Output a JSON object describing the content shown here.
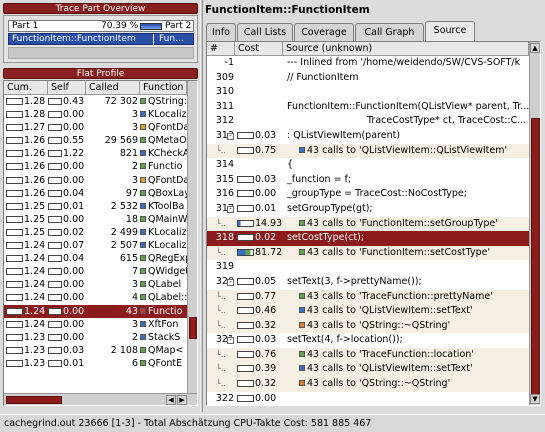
{
  "overview": {
    "dock_title": "Trace Part Overview",
    "part1": "Part 1",
    "percent": "70.39 %",
    "part2": "Part 2",
    "func1": "FunctionItem::FunctionItem",
    "func2": "Fun..."
  },
  "flat": {
    "dock_title": "Flat Profile",
    "headers": [
      "Cum.",
      "Self",
      "Called",
      "Function"
    ],
    "rows": [
      {
        "cum": "1.28",
        "self": "0.43",
        "called": "72 302",
        "color": "#5fa64f",
        "func": "QString::"
      },
      {
        "cum": "1.28",
        "self": "0.00",
        "called": "3",
        "color": "#3a6fc8",
        "func": "KLocalize"
      },
      {
        "cum": "1.27",
        "self": "0.00",
        "called": "3",
        "color": "#e0a030",
        "func": "QFontDa"
      },
      {
        "cum": "1.26",
        "self": "0.55",
        "called": "29 569",
        "color": "#5fa64f",
        "func": "QMetaO"
      },
      {
        "cum": "1.26",
        "self": "1.22",
        "called": "821",
        "color": "#3a6fc8",
        "func": "KCheckA"
      },
      {
        "cum": "1.26",
        "self": "0.00",
        "called": "2",
        "color": "#5fa64f",
        "func": "Functio"
      },
      {
        "cum": "1.26",
        "self": "0.00",
        "called": "3",
        "color": "#e0a030",
        "func": "QFontDa"
      },
      {
        "cum": "1.26",
        "self": "0.04",
        "called": "97",
        "color": "#5fa64f",
        "func": "QBoxLay"
      },
      {
        "cum": "1.25",
        "self": "0.01",
        "called": "2 532",
        "color": "#3a6fc8",
        "func": "KToolBa"
      },
      {
        "cum": "1.25",
        "self": "0.00",
        "called": "18",
        "color": "#5fa64f",
        "func": "QMainW"
      },
      {
        "cum": "1.25",
        "self": "0.02",
        "called": "2 499",
        "color": "#3a6fc8",
        "func": "KLocalize"
      },
      {
        "cum": "1.24",
        "self": "0.07",
        "called": "2 507",
        "color": "#3a6fc8",
        "func": "KLocalize"
      },
      {
        "cum": "1.24",
        "self": "0.04",
        "called": "615",
        "color": "#5fa64f",
        "func": "QRegExp"
      },
      {
        "cum": "1.24",
        "self": "0.00",
        "called": "7",
        "color": "#5fa64f",
        "func": "QWidget"
      },
      {
        "cum": "1.24",
        "self": "0.00",
        "called": "3",
        "color": "#5fa64f",
        "func": "QLabel"
      },
      {
        "cum": "1.24",
        "self": "0.00",
        "called": "4",
        "color": "#5fa64f",
        "func": "QLabel::"
      },
      {
        "cum": "1.24",
        "self": "0.00",
        "called": "43",
        "color": "#c33",
        "func": "Functio",
        "selected": true
      },
      {
        "cum": "1.24",
        "self": "0.00",
        "called": "3",
        "color": "#3a6fc8",
        "func": "XftFon"
      },
      {
        "cum": "1.23",
        "self": "0.00",
        "called": "2",
        "color": "#3a6fc8",
        "func": "StackS"
      },
      {
        "cum": "1.23",
        "self": "0.03",
        "called": "2 108",
        "color": "#5fa64f",
        "func": "QMap<"
      },
      {
        "cum": "1.23",
        "self": "0.01",
        "called": "6",
        "color": "#5fa64f",
        "func": "QFontE"
      }
    ]
  },
  "main": {
    "title": "FunctionItem::FunctionItem",
    "tabs": [
      "Info",
      "Call Lists",
      "Coverage",
      "Call Graph",
      "Source"
    ],
    "active_tab": "Source",
    "src_headers": [
      "#",
      "Cost",
      "Source (unknown)"
    ],
    "src_rows": [
      {
        "num": "-1",
        "cost": "",
        "hasbar": false,
        "text": "--- Inlined from '/home/weidendo/SW/CVS-SOFT/k"
      },
      {
        "num": "309",
        "cost": "",
        "hasbar": false,
        "text": "// FunctionItem"
      },
      {
        "num": "310",
        "cost": "",
        "hasbar": false,
        "text": ""
      },
      {
        "num": "311",
        "cost": "",
        "hasbar": false,
        "text": "FunctionItem::FunctionItem(QListView* parent, Tr..."
      },
      {
        "num": "312",
        "cost": "",
        "hasbar": false,
        "text": "TraceCostType* ct, TraceCost::C...",
        "indent": true
      },
      {
        "num": "313",
        "cost": "0.03",
        "hasbar": true,
        "text": ": QListViewItem(parent)",
        "tree": "expand"
      },
      {
        "num": "",
        "cost": "0.75",
        "hasbar": true,
        "sq": "#3a6fc8",
        "text": "43 calls to 'QListViewItem::QListViewItem'",
        "call": true,
        "tint": true
      },
      {
        "num": "314",
        "cost": "",
        "hasbar": false,
        "text": "{"
      },
      {
        "num": "315",
        "cost": "0.03",
        "hasbar": true,
        "text": "_function = f;"
      },
      {
        "num": "316",
        "cost": "0.00",
        "hasbar": true,
        "text": "_groupType = TraceCost::NoCostType;"
      },
      {
        "num": "317",
        "cost": "0.01",
        "hasbar": true,
        "text": "setGroupType(gt);",
        "tree": "expand"
      },
      {
        "num": "",
        "cost": "14.93",
        "hasbar": true,
        "fill": "#3a6fc8",
        "sq": "#5fa64f",
        "text": "43 calls to 'FunctionItem::setGroupType'",
        "call": true,
        "tint": true
      },
      {
        "num": "318",
        "cost": "0.02",
        "hasbar": true,
        "text": "setCostType(ct);",
        "selected": true
      },
      {
        "num": "",
        "cost": "81.72",
        "hasbar": true,
        "fill": "#3a6fc8",
        "fill2": "#5fa64f",
        "sq": "#5fa64f",
        "text": "43 calls to 'FunctionItem::setCostType'",
        "call": true,
        "tint": true
      },
      {
        "num": "319",
        "cost": "",
        "hasbar": false,
        "text": ""
      },
      {
        "num": "320",
        "cost": "0.05",
        "hasbar": true,
        "text": "setText(3, f->prettyName());",
        "tree": "expand"
      },
      {
        "num": "",
        "cost": "0.77",
        "hasbar": true,
        "sq": "#5fa64f",
        "text": "43 calls to 'TraceFunction::prettyName'",
        "call": true,
        "tint": true
      },
      {
        "num": "",
        "cost": "0.46",
        "hasbar": true,
        "sq": "#3a6fc8",
        "text": "43 calls to 'QListViewItem::setText'",
        "call": true,
        "tint": true
      },
      {
        "num": "",
        "cost": "0.32",
        "hasbar": true,
        "sq": "#e07a30",
        "text": "43 calls to 'QString::~QString'",
        "call": true,
        "tint": true
      },
      {
        "num": "321",
        "cost": "0.03",
        "hasbar": true,
        "text": "setText(4, f->location());",
        "tree": "expand"
      },
      {
        "num": "",
        "cost": "0.76",
        "hasbar": true,
        "sq": "#5fa64f",
        "text": "43 calls to 'TraceFunction::location'",
        "call": true,
        "tint": true
      },
      {
        "num": "",
        "cost": "0.39",
        "hasbar": true,
        "sq": "#3a6fc8",
        "text": "43 calls to 'QListViewItem::setText'",
        "call": true,
        "tint": true
      },
      {
        "num": "",
        "cost": "0.32",
        "hasbar": true,
        "sq": "#e07a30",
        "text": "43 calls to 'QString::~QString'",
        "call": true,
        "tint": true
      },
      {
        "num": "322",
        "cost": "0.00",
        "hasbar": true,
        "text": ""
      }
    ]
  },
  "status": {
    "text": "cachegrind.out 23666 [1-3] - Total Abschätzung CPU-Takte Cost:  581 885 467"
  }
}
